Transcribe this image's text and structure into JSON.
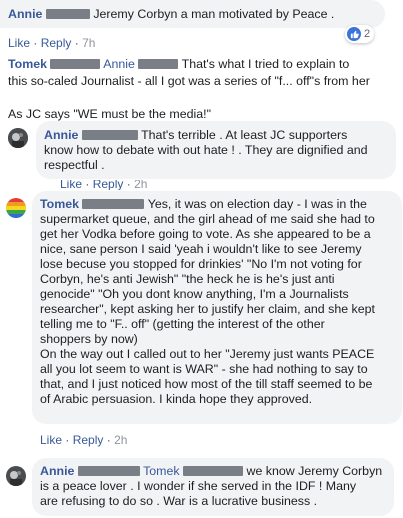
{
  "comments": [
    {
      "author": "Annie",
      "text": "Jeremy Corbyn a man motivated by Peace .",
      "like": "Like",
      "reply": "Reply",
      "sep": "·",
      "time": "7h",
      "reactions": "2"
    },
    {
      "author": "Tomek",
      "mention": "Annie",
      "text_line1": "That's what I tried to explain to",
      "text_line2": "this so-caled Journalist - all I got was a series of \"f... off\"s from her",
      "text_para2": "As JC says \"WE must be the media!\""
    },
    {
      "author": "Annie",
      "text_line1": "That's terrible . At least JC supporters",
      "text_line2": "know how to debate with out hate ! . They are dignified and",
      "text_line3": "respectful .",
      "like": "Like",
      "reply": "Reply",
      "sep": "·",
      "time": "2h"
    },
    {
      "author": "Tomek",
      "text_first": "Yes, it was on election day - I was in the",
      "lines": [
        "supermarket queue, and the girl ahead of me said she had to",
        "get her Vodka before going to vote. As she appeared to be a",
        "nice, sane person I said 'yeah i wouldn't like to see Jeremy",
        "lose becuse you stopped for drinkies' \"No I'm not voting for",
        "Corbyn, he's anti Jewish\" \"the heck he is he's just anti",
        "genocide\" \"Oh you dont know anything, I'm a Journalists",
        "researcher\", kept asking her to justify her claim, and she kept",
        "telling me to \"F.. off\" (getting the interest of the other",
        "shoppers by now)",
        "On the way out I called out to her \"Jeremy just wants PEACE",
        "all you lot seem to want is WAR\" - she had nothing to say to",
        "that, and I just noticed how most of the till staff seemed to be",
        "of Arabic persuasion. I kinda hope they approved."
      ],
      "like": "Like",
      "reply": "Reply",
      "sep": "·",
      "time": "2h"
    },
    {
      "author": "Annie",
      "mention": "Tomek",
      "text_first": "we know Jeremy Corbyn",
      "lines": [
        "is a peace lover . I wonder if she served in the IDF ! Many",
        "are refusing to do so . War is a lucrative business ."
      ]
    }
  ]
}
